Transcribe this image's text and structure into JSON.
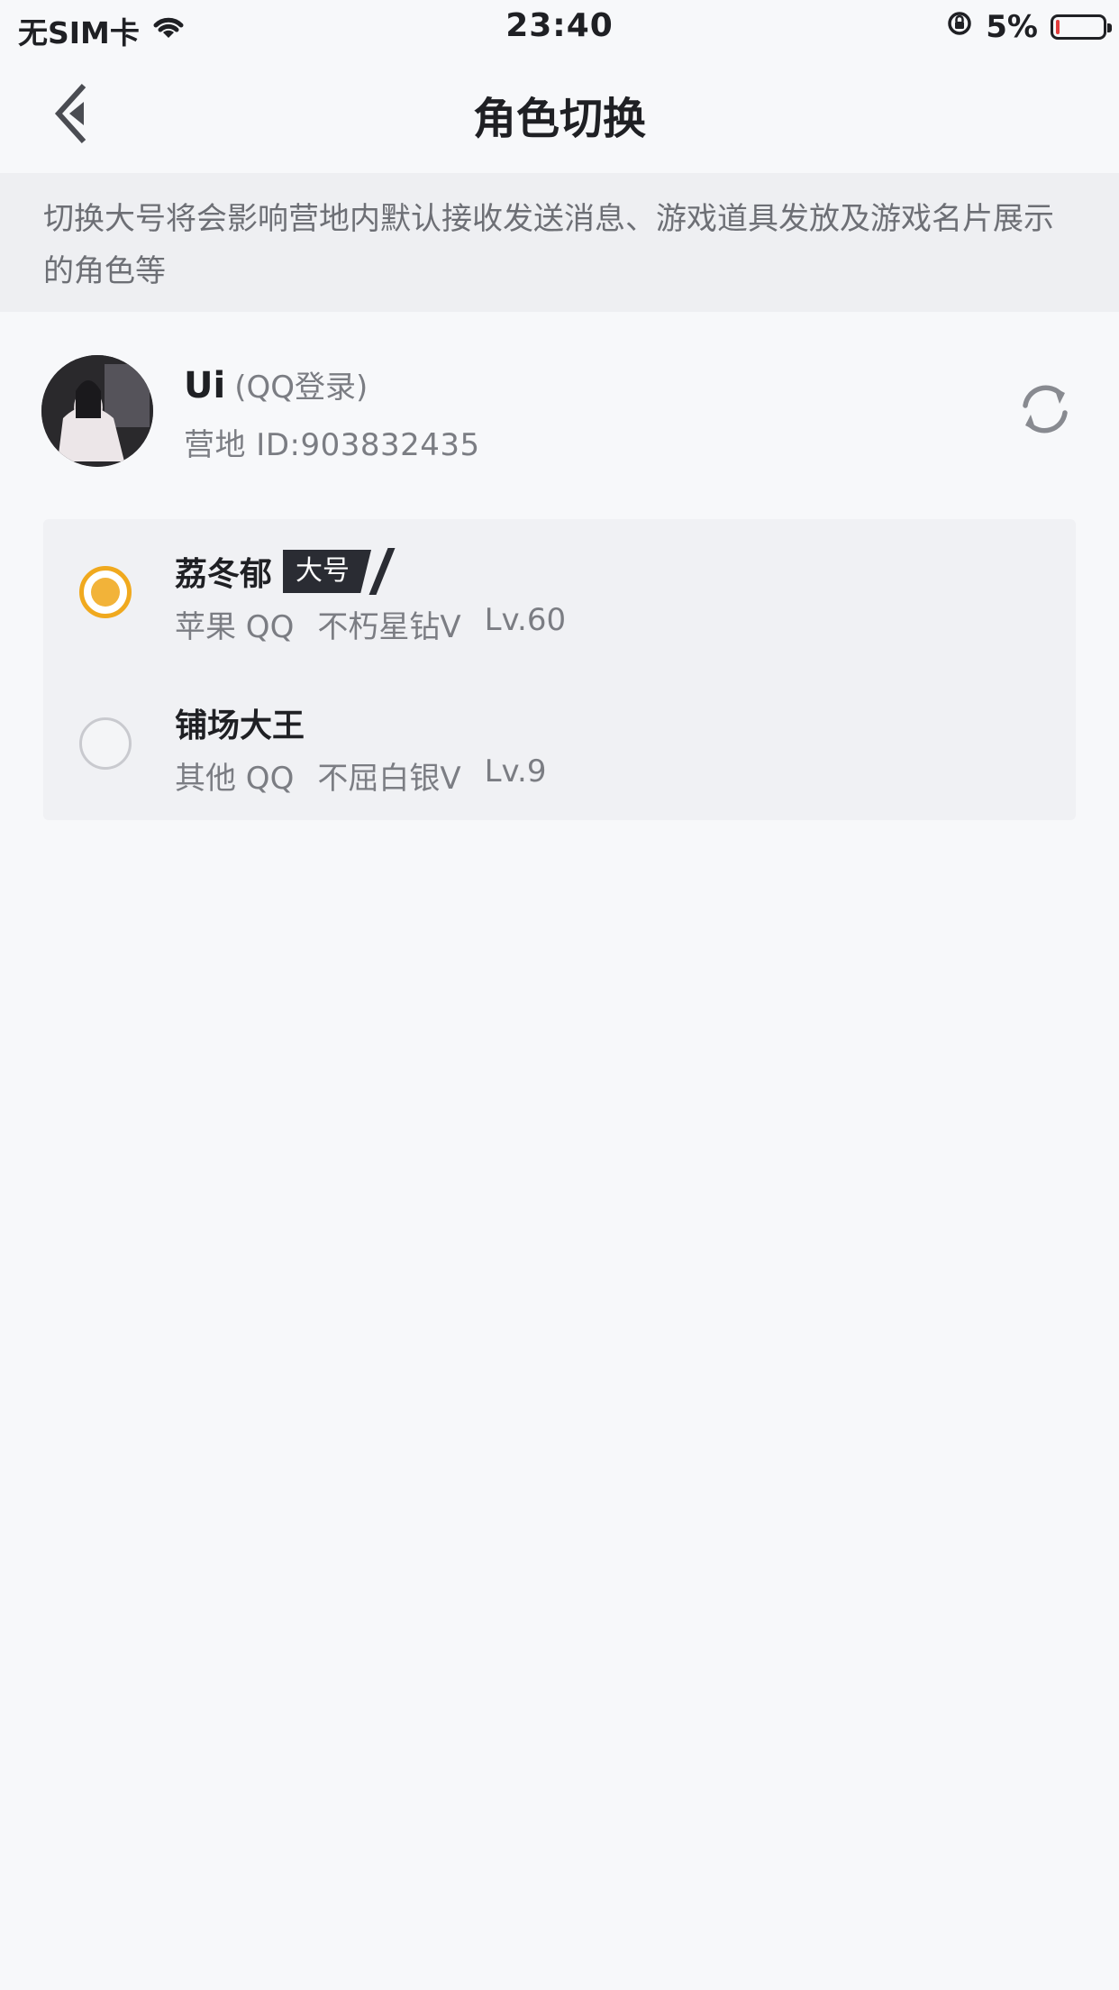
{
  "status_bar": {
    "carrier": "无SIM卡",
    "time": "23:40",
    "battery": "5%",
    "battery_level": 0.05,
    "icons": [
      "wifi-icon",
      "rotation-lock-icon",
      "battery-icon"
    ]
  },
  "nav": {
    "title": "角色切换",
    "back_icon": "chevron-left-icon"
  },
  "notice": {
    "text": "切换大号将会影响营地内默认接收发送消息、游戏道具发放及游戏名片展示的角色等"
  },
  "account": {
    "name": "Ui",
    "login": "(QQ登录)",
    "id": "营地 ID:903832435",
    "refresh_icon": "refresh-icon"
  },
  "roles": [
    {
      "name": "荔冬郁",
      "badge": "大号",
      "platform": "苹果 QQ",
      "rank": "不朽星钻Ⅴ",
      "level": "Lv.60",
      "selected": true
    },
    {
      "name": "铺场大王",
      "badge": "",
      "platform": "其他 QQ",
      "rank": "不屈白银Ⅴ",
      "level": "Lv.9",
      "selected": false
    }
  ],
  "colors": {
    "accent": "#f2b339",
    "badge_bg": "#2a2c33",
    "background": "#f7f8fa"
  }
}
